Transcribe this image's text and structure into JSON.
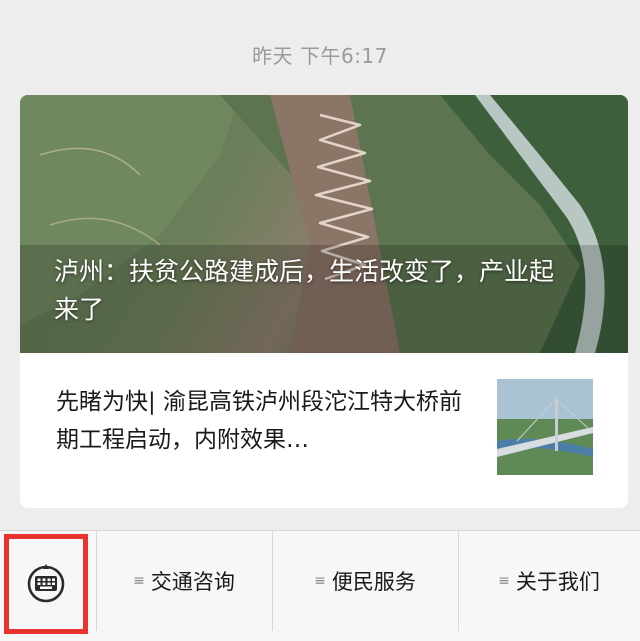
{
  "timestamp": "昨天 下午6:17",
  "article": {
    "main_title": "泸州：扶贫公路建成后，生活改变了，产业起来了",
    "sub_title": "先睹为快| 渝昆高铁泸州段沱江特大桥前期工程启动，内附效果…"
  },
  "menu": {
    "items": [
      {
        "label": "交通咨询",
        "icon": "menu-lines-icon"
      },
      {
        "label": "便民服务",
        "icon": "menu-lines-icon"
      },
      {
        "label": "关于我们",
        "icon": "menu-lines-icon"
      }
    ],
    "keyboard_icon": "keyboard-icon"
  },
  "colors": {
    "background": "#ededed",
    "highlight_border": "#e8332f"
  }
}
